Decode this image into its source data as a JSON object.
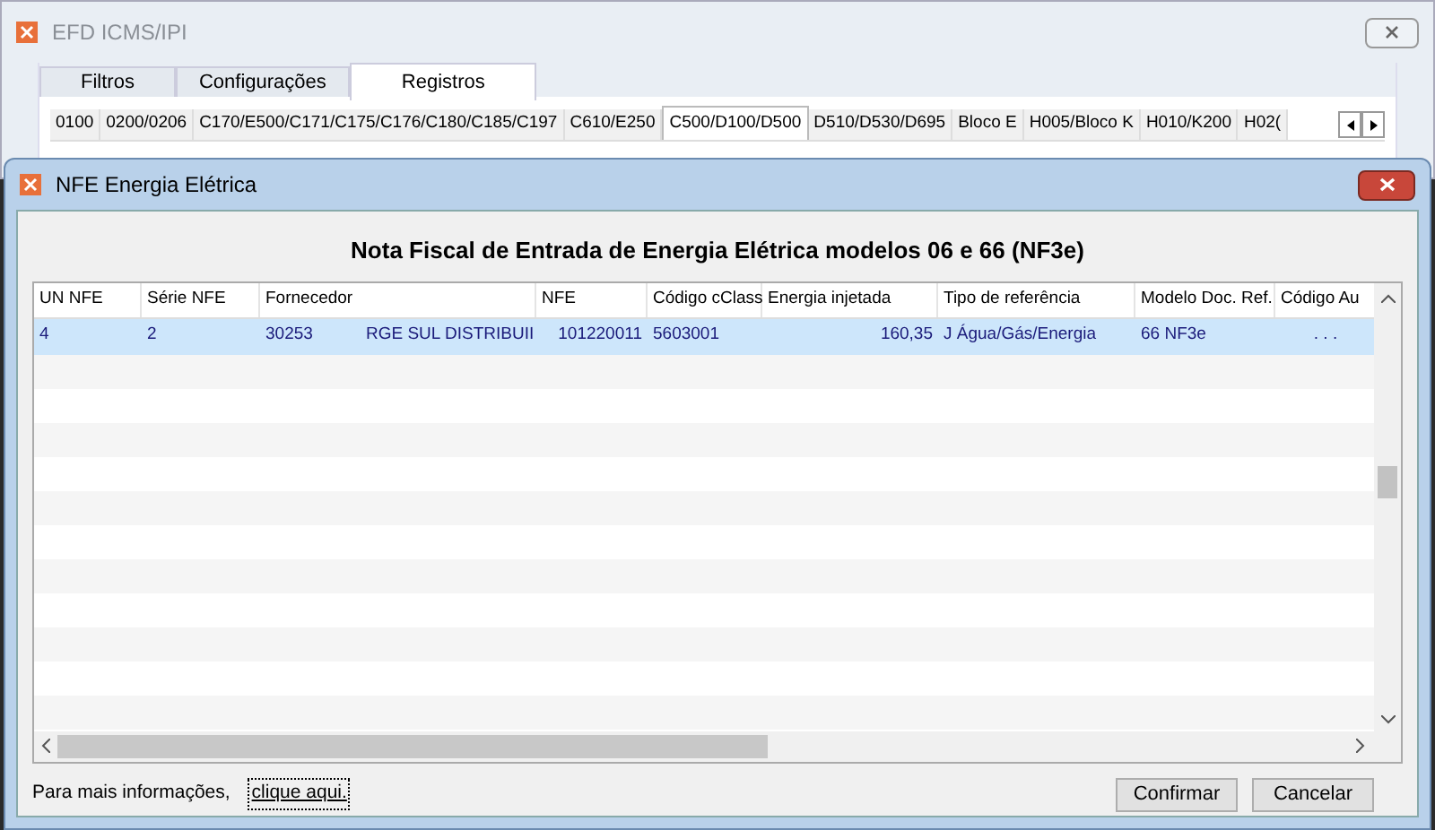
{
  "window": {
    "title": "EFD ICMS/IPI"
  },
  "tabs": [
    {
      "label": "Filtros",
      "selected": false
    },
    {
      "label": "Configurações",
      "selected": false
    },
    {
      "label": "Registros",
      "selected": true
    }
  ],
  "subtabs": [
    {
      "label": "0100",
      "selected": false
    },
    {
      "label": "0200/0206",
      "selected": false
    },
    {
      "label": "C170/E500/C171/C175/C176/C180/C185/C197",
      "selected": false
    },
    {
      "label": "C610/E250",
      "selected": false
    },
    {
      "label": "C500/D100/D500",
      "selected": true
    },
    {
      "label": "D510/D530/D695",
      "selected": false
    },
    {
      "label": "Bloco E",
      "selected": false
    },
    {
      "label": "H005/Bloco K",
      "selected": false
    },
    {
      "label": "H010/K200",
      "selected": false
    },
    {
      "label": "H02(",
      "selected": false
    }
  ],
  "dialog": {
    "title": "NFE Energia Elétrica",
    "heading": "Nota Fiscal de Entrada de Energia Elétrica modelos 06 e 66 (NF3e)",
    "table": {
      "columns": [
        "UN NFE",
        "Série NFE",
        "Fornecedor",
        "NFE",
        "Código cClass",
        "Energia injetada",
        "Tipo de referência",
        "Modelo Doc. Ref.",
        "Código Au"
      ],
      "rows": [
        {
          "selected": true,
          "cells": [
            "4",
            "2",
            "30253 RGE SUL DISTRIBUII",
            "101220011",
            "5603001",
            "160,35",
            "J Água/Gás/Energia",
            "66 NF3e",
            ". . ."
          ]
        }
      ]
    },
    "footer_text": "Para mais informações,",
    "link": "clique aqui.",
    "buttons": [
      "Confirmar",
      "Cancelar"
    ]
  }
}
